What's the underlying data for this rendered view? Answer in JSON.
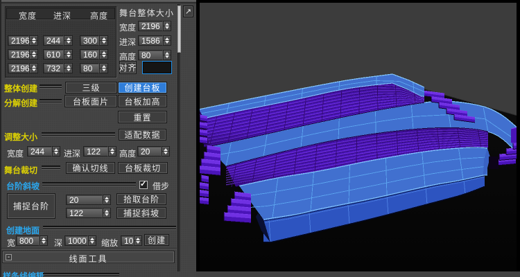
{
  "window": {
    "kind": "3d-modeling-tool-panel",
    "language": "zh-CN"
  },
  "ui": {
    "grid_box": {
      "headers": [
        "宽度",
        "进深",
        "高度"
      ],
      "rows": [
        [
          "2196",
          "244",
          "300"
        ],
        [
          "2196",
          "610",
          "160"
        ],
        [
          "2196",
          "732",
          "80"
        ]
      ]
    },
    "overall": {
      "title": "舞台整体大小",
      "rows": [
        {
          "label": "宽度",
          "value": "2196"
        },
        {
          "label": "进深",
          "value": "1586"
        },
        {
          "label": "高度",
          "value": "80"
        }
      ],
      "align_button": "对齐",
      "align_value": ""
    },
    "expand_icon": "↗",
    "sections": {
      "create_whole": {
        "label": "整体创建",
        "btn1": "三级",
        "btn2": "创建台板"
      },
      "create_split": {
        "label": "分解创建",
        "btn1": "台板面片",
        "btn2": "台板加高"
      },
      "reset_btn": "重置",
      "resize": {
        "label": "调整大小",
        "btn": "适配数据",
        "fields": [
          {
            "label": "宽度",
            "value": "244"
          },
          {
            "label": "进深",
            "value": "122"
          },
          {
            "label": "高度",
            "value": "20"
          }
        ]
      },
      "crop": {
        "label": "舞台裁切",
        "btn1": "确认切线",
        "btn2": "台板裁切"
      },
      "steps": {
        "label": "台阶斜坡",
        "checkbox_label": "借步",
        "checked": true,
        "check_glyph": "✓",
        "big_btn": "捕捉台阶",
        "field1": "20",
        "btn1": "拾取台阶",
        "field2": "122",
        "btn2": "捕捉斜坡"
      },
      "ground": {
        "label": "创建地面",
        "fields": [
          {
            "label": "宽",
            "value": "800"
          },
          {
            "label": "深",
            "value": "1000"
          },
          {
            "label": "缩放",
            "value": "10"
          }
        ],
        "btn": "创建"
      },
      "rollout": {
        "collapse_icon": "-",
        "title": "线面工具"
      },
      "spline": {
        "label": "样条线编辑"
      }
    }
  },
  "viewport": {
    "colors": {
      "backdrop_wall": "#3c3c3c",
      "floor": "#0a0a0a",
      "platform_blue": "#4170cf",
      "platform_grid": "#5ba4ef",
      "platform_front": "#2d54c0",
      "riser_purple": "#4a14b8",
      "riser_highlight": "#6f30e2",
      "accent_yellow": "#ddd104",
      "accent_cyan": "#2ba6ec",
      "selected_button_blue": "#2f7dd9",
      "pick_field_border": "#1f8fe8"
    },
    "statusbar": ""
  }
}
